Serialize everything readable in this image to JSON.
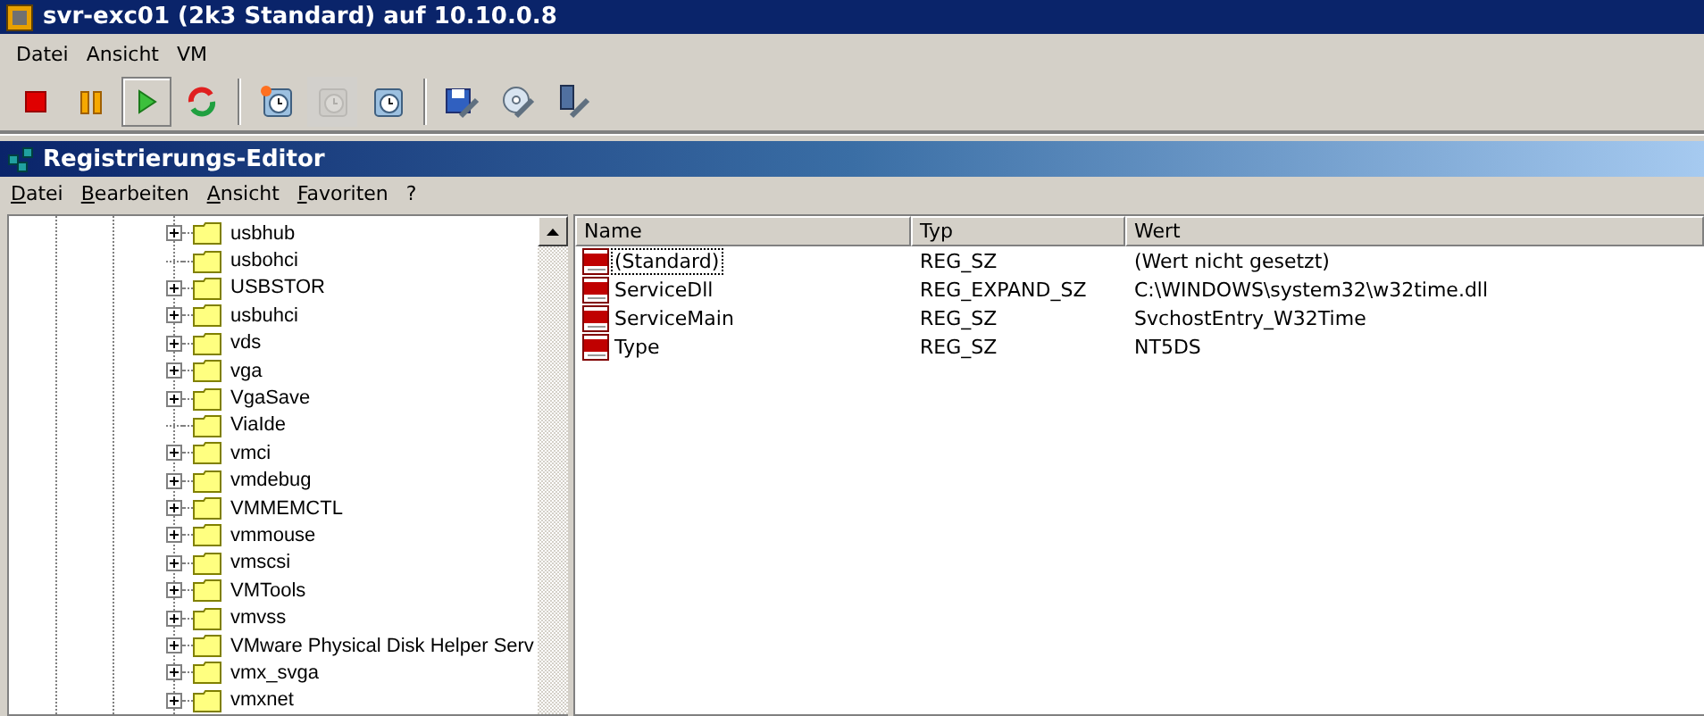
{
  "window": {
    "title": "svr-exc01 (2k3 Standard) auf 10.10.0.8"
  },
  "menu": [
    "Datei",
    "Ansicht",
    "VM"
  ],
  "toolbar": [
    {
      "kind": "stop",
      "selected": false,
      "disabled": false
    },
    {
      "kind": "pause",
      "selected": false,
      "disabled": false
    },
    {
      "kind": "play",
      "selected": true,
      "disabled": false
    },
    {
      "kind": "reset",
      "selected": false,
      "disabled": false
    },
    {
      "kind": "separator"
    },
    {
      "kind": "snapshot",
      "selected": false,
      "disabled": false
    },
    {
      "kind": "revert",
      "selected": false,
      "disabled": true
    },
    {
      "kind": "manager",
      "selected": false,
      "disabled": false
    },
    {
      "kind": "separator"
    },
    {
      "kind": "floppy",
      "selected": false,
      "disabled": false
    },
    {
      "kind": "cd",
      "selected": false,
      "disabled": false
    },
    {
      "kind": "usb",
      "selected": false,
      "disabled": false
    }
  ],
  "regedit": {
    "title": "Registrierungs-Editor",
    "menu": [
      "Datei",
      "Bearbeiten",
      "Ansicht",
      "Favoriten",
      "?"
    ],
    "tree": [
      {
        "label": "usbhub",
        "expandable": true
      },
      {
        "label": "usbohci",
        "expandable": false
      },
      {
        "label": "USBSTOR",
        "expandable": true
      },
      {
        "label": "usbuhci",
        "expandable": true
      },
      {
        "label": "vds",
        "expandable": true
      },
      {
        "label": "vga",
        "expandable": true
      },
      {
        "label": "VgaSave",
        "expandable": true
      },
      {
        "label": "ViaIde",
        "expandable": false
      },
      {
        "label": "vmci",
        "expandable": true
      },
      {
        "label": "vmdebug",
        "expandable": true
      },
      {
        "label": "VMMEMCTL",
        "expandable": true
      },
      {
        "label": "vmmouse",
        "expandable": true
      },
      {
        "label": "vmscsi",
        "expandable": true
      },
      {
        "label": "VMTools",
        "expandable": true
      },
      {
        "label": "vmvss",
        "expandable": true
      },
      {
        "label": "VMware Physical Disk Helper Serv",
        "expandable": true
      },
      {
        "label": "vmx_svga",
        "expandable": true
      },
      {
        "label": "vmxnet",
        "expandable": true
      }
    ],
    "columns": [
      "Name",
      "Typ",
      "Wert"
    ],
    "values": [
      {
        "name": "(Standard)",
        "type": "REG_SZ",
        "data": "(Wert nicht gesetzt)",
        "focused": true
      },
      {
        "name": "ServiceDll",
        "type": "REG_EXPAND_SZ",
        "data": "C:\\WINDOWS\\system32\\w32time.dll",
        "focused": false
      },
      {
        "name": "ServiceMain",
        "type": "REG_SZ",
        "data": "SvchostEntry_W32Time",
        "focused": false
      },
      {
        "name": "Type",
        "type": "REG_SZ",
        "data": "NT5DS",
        "focused": false
      }
    ]
  }
}
